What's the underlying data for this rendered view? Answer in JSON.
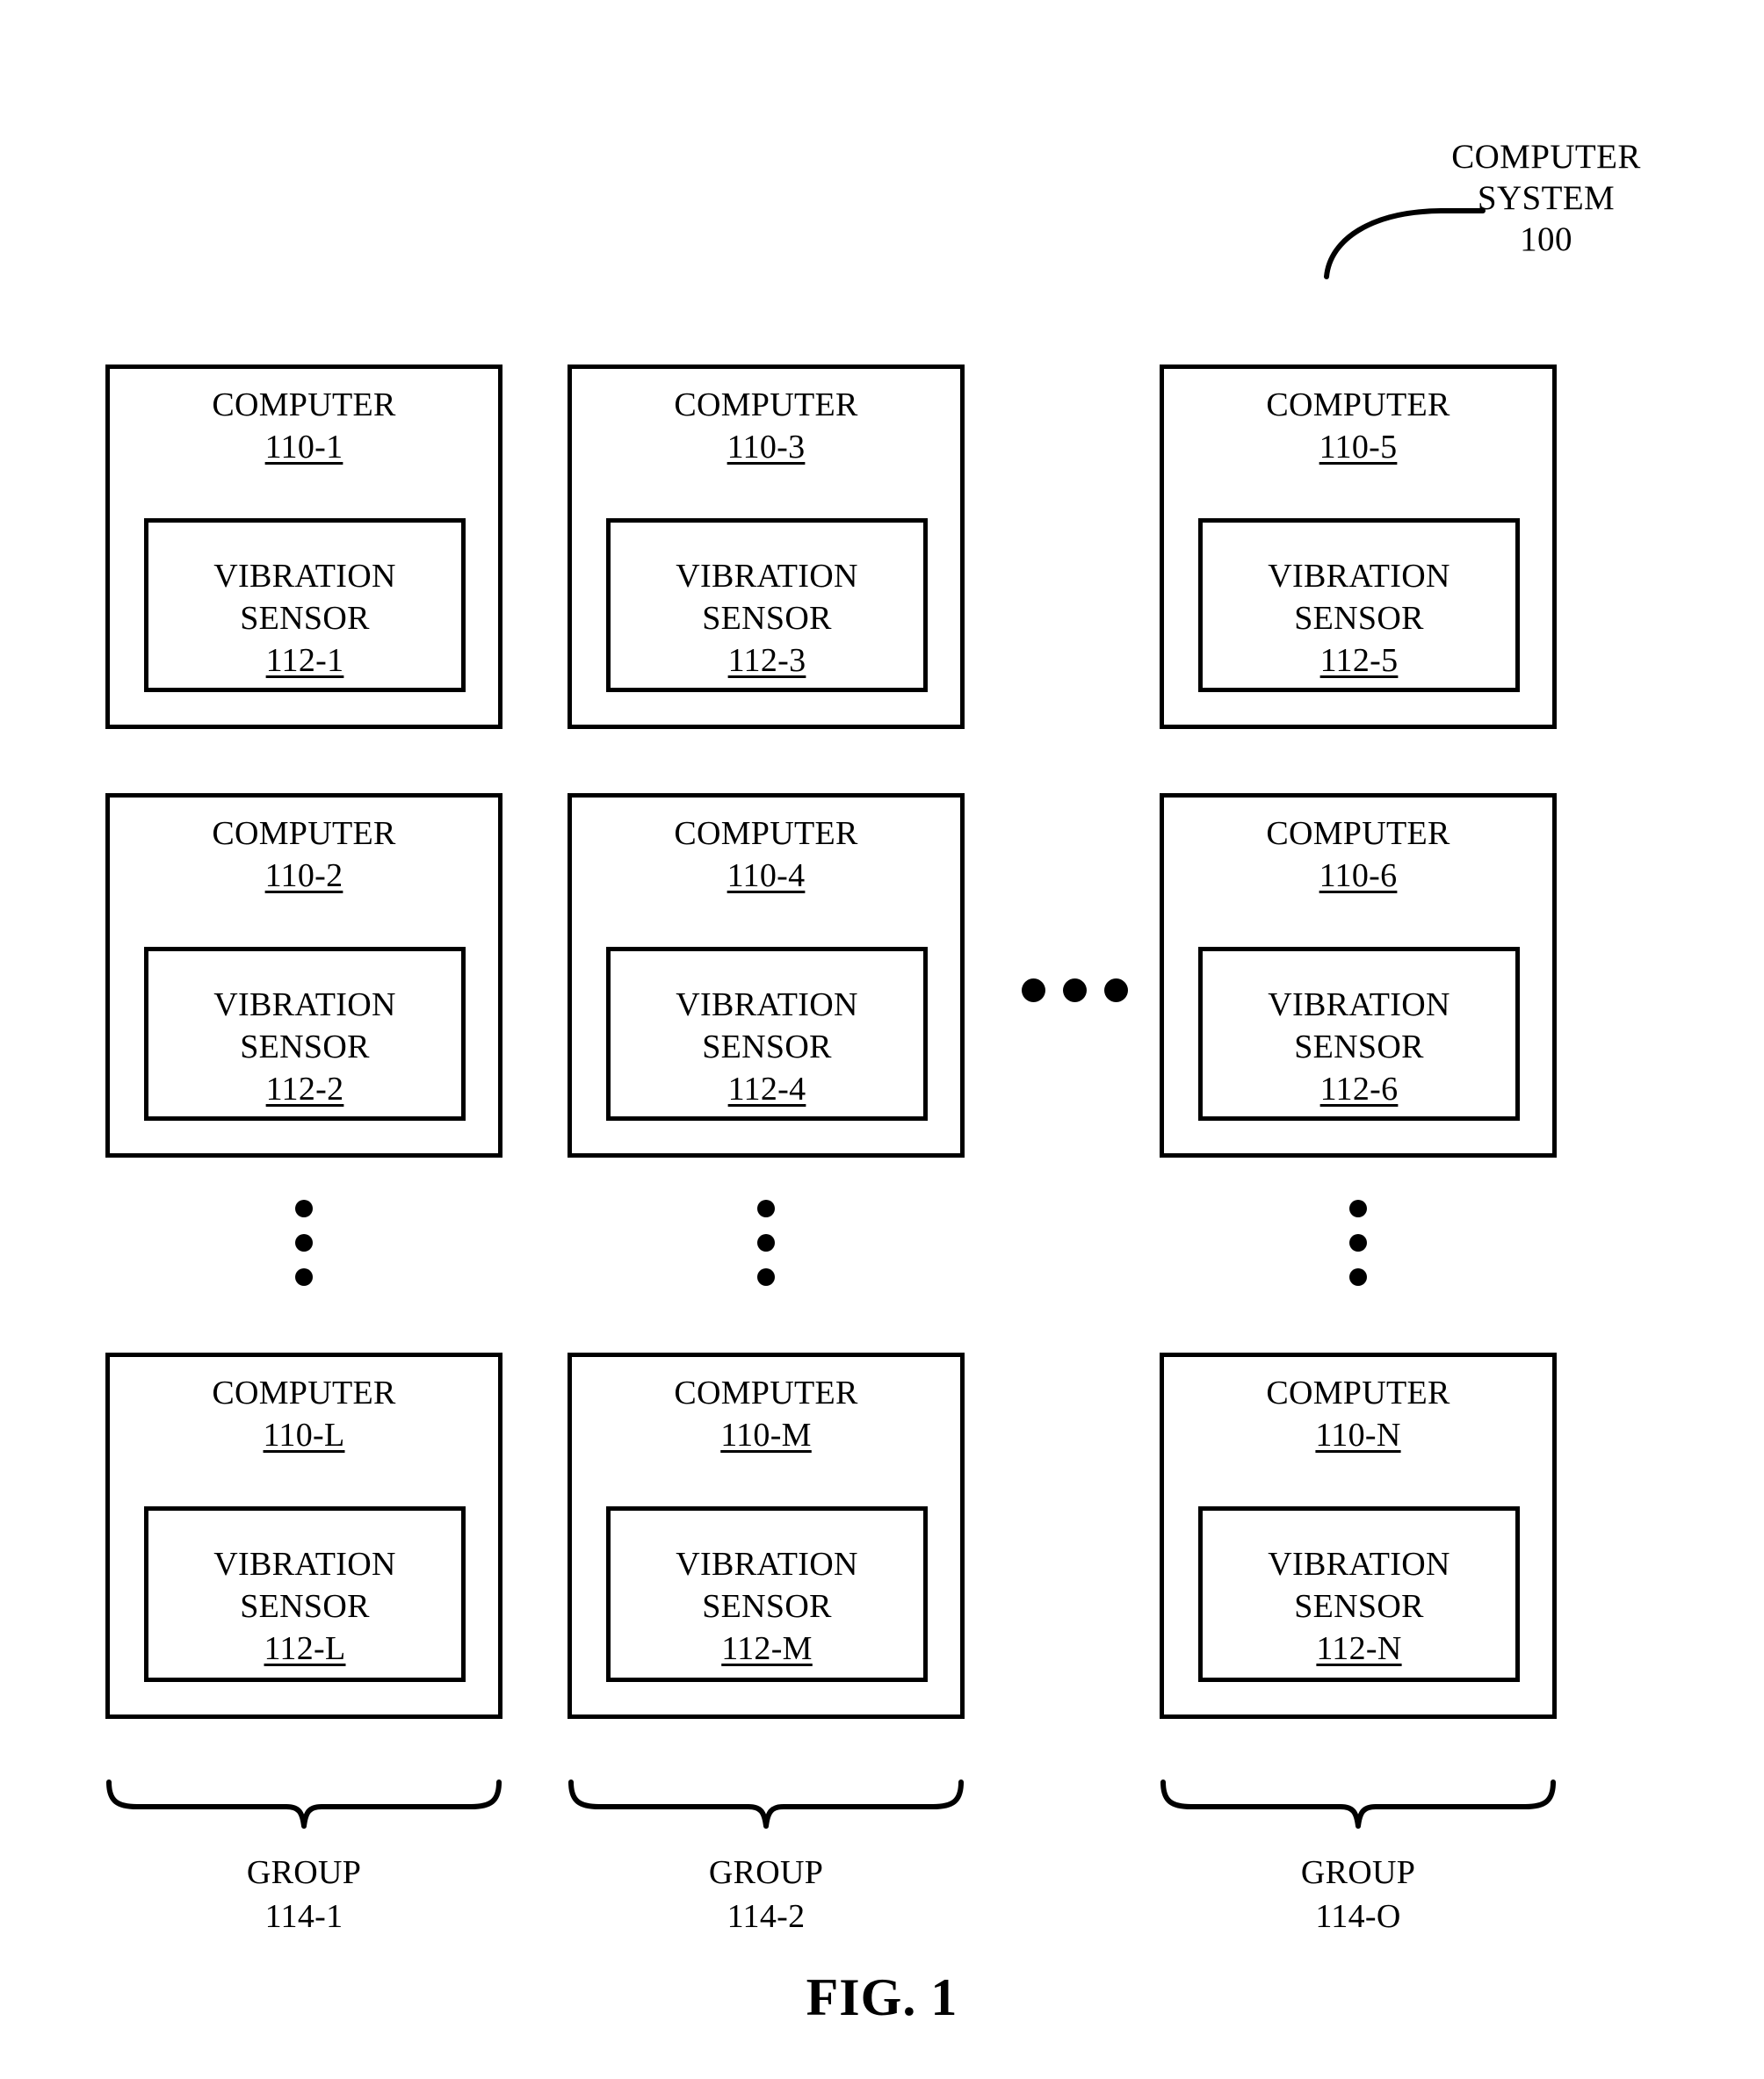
{
  "figure": {
    "caption": "FIG. 1",
    "system_callout": {
      "line1": "COMPUTER",
      "line2": "SYSTEM",
      "line3": "100"
    }
  },
  "columns": [
    {
      "group": {
        "title": "GROUP",
        "ref": "114-1"
      },
      "computers": [
        {
          "title": "COMPUTER",
          "ref": "110-1",
          "sensor": {
            "line1": "VIBRATION",
            "line2": "SENSOR",
            "ref": "112-1"
          }
        },
        {
          "title": "COMPUTER",
          "ref": "110-2",
          "sensor": {
            "line1": "VIBRATION",
            "line2": "SENSOR",
            "ref": "112-2"
          }
        },
        {
          "title": "COMPUTER",
          "ref": "110-L",
          "sensor": {
            "line1": "VIBRATION",
            "line2": "SENSOR",
            "ref": "112-L"
          }
        }
      ]
    },
    {
      "group": {
        "title": "GROUP",
        "ref": "114-2"
      },
      "computers": [
        {
          "title": "COMPUTER",
          "ref": "110-3",
          "sensor": {
            "line1": "VIBRATION",
            "line2": "SENSOR",
            "ref": "112-3"
          }
        },
        {
          "title": "COMPUTER",
          "ref": "110-4",
          "sensor": {
            "line1": "VIBRATION",
            "line2": "SENSOR",
            "ref": "112-4"
          }
        },
        {
          "title": "COMPUTER",
          "ref": "110-M",
          "sensor": {
            "line1": "VIBRATION",
            "line2": "SENSOR",
            "ref": "112-M"
          }
        }
      ]
    },
    {
      "group": {
        "title": "GROUP",
        "ref": "114-O"
      },
      "computers": [
        {
          "title": "COMPUTER",
          "ref": "110-5",
          "sensor": {
            "line1": "VIBRATION",
            "line2": "SENSOR",
            "ref": "112-5"
          }
        },
        {
          "title": "COMPUTER",
          "ref": "110-6",
          "sensor": {
            "line1": "VIBRATION",
            "line2": "SENSOR",
            "ref": "112-6"
          }
        },
        {
          "title": "COMPUTER",
          "ref": "110-N",
          "sensor": {
            "line1": "VIBRATION",
            "line2": "SENSOR",
            "ref": "112-N"
          }
        }
      ]
    }
  ],
  "colors": {
    "stroke": "#000000",
    "background": "#ffffff"
  }
}
